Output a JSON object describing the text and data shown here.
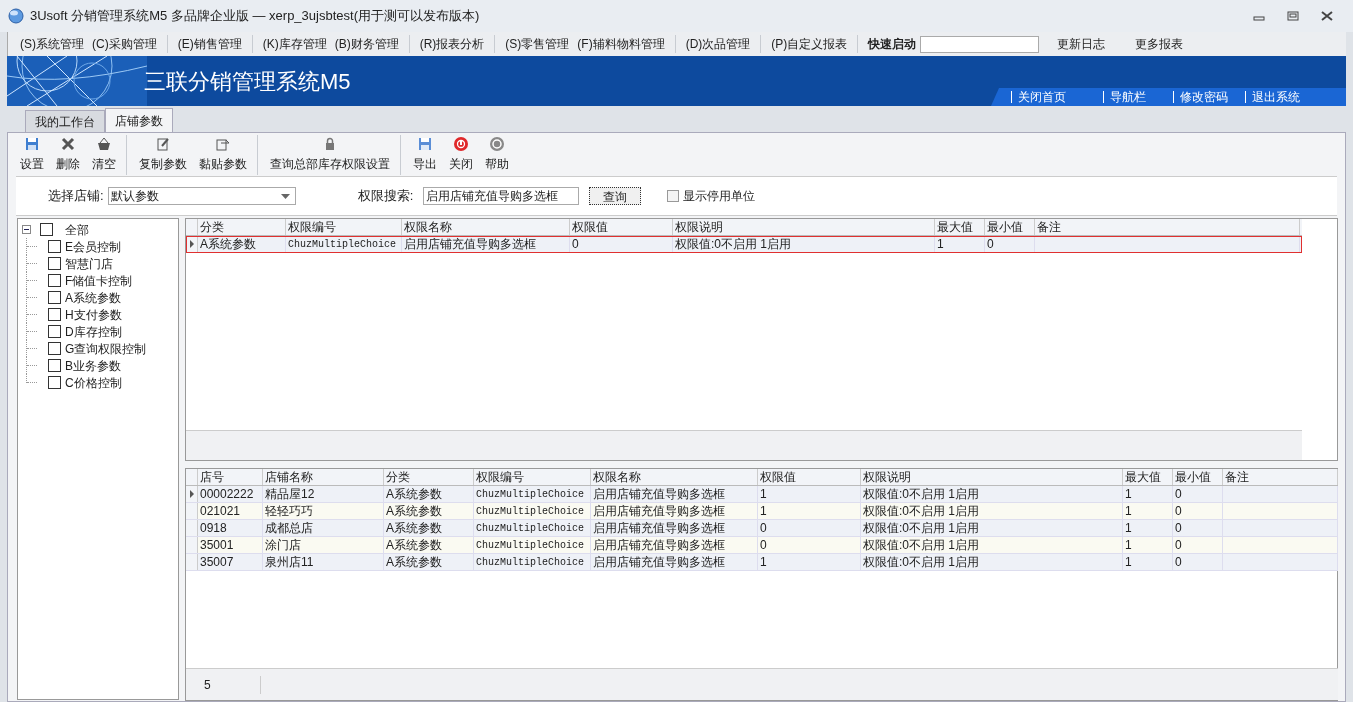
{
  "window": {
    "title": "3Usoft 分销管理系统M5 多品牌企业版 — xerp_3ujsbtest(用于测可以发布版本)"
  },
  "menu": [
    {
      "label": "(S)系统管理",
      "group_end": false
    },
    {
      "label": "(C)采购管理",
      "group_end": true
    },
    {
      "label": "(E)销售管理",
      "group_end": true
    },
    {
      "label": "(K)库存管理",
      "group_end": false
    },
    {
      "label": "(B)财务管理",
      "group_end": true
    },
    {
      "label": "(R)报表分析",
      "group_end": true
    },
    {
      "label": "(S)零售管理",
      "group_end": false
    },
    {
      "label": "(F)辅料物料管理",
      "group_end": true
    },
    {
      "label": "(D)次品管理",
      "group_end": true
    },
    {
      "label": "(P)自定义报表",
      "group_end": true
    }
  ],
  "quick_launch": {
    "label": "快速启动"
  },
  "menu_links": [
    "更新日志",
    "更多报表"
  ],
  "banner": {
    "title": "三联分销管理系统M5",
    "links": [
      "关闭首页",
      "导航栏",
      "修改密码",
      "退出系统"
    ]
  },
  "tabs": [
    {
      "label": "我的工作台",
      "selected": false
    },
    {
      "label": "店铺参数",
      "selected": true
    }
  ],
  "toolbar": [
    {
      "label": "设置",
      "group_end": false
    },
    {
      "label": "删除",
      "group_end": false
    },
    {
      "label": "清空",
      "group_end": true
    },
    {
      "label": "复制参数",
      "group_end": false
    },
    {
      "label": "黏贴参数",
      "group_end": true
    },
    {
      "label": "查询总部库存权限设置",
      "group_end": true
    },
    {
      "label": "导出",
      "group_end": false
    },
    {
      "label": "关闭",
      "group_end": false
    },
    {
      "label": "帮助",
      "group_end": false
    }
  ],
  "filter": {
    "store_label": "选择店铺:",
    "store_value": "默认参数",
    "search_label": "权限搜索:",
    "search_value": "启用店铺充值导购多选框",
    "search_button": "查询",
    "show_disabled": {
      "label": "显示停用单位",
      "checked": false
    }
  },
  "tree": {
    "label": "全部",
    "checked": false,
    "expanded": true,
    "children": [
      {
        "label": "E会员控制",
        "checked": false
      },
      {
        "label": "智慧门店",
        "checked": false
      },
      {
        "label": "F储值卡控制",
        "checked": false
      },
      {
        "label": "A系统参数",
        "checked": false
      },
      {
        "label": "H支付参数",
        "checked": false
      },
      {
        "label": "D库存控制",
        "checked": false
      },
      {
        "label": "G查询权限控制",
        "checked": false
      },
      {
        "label": "B业务参数",
        "checked": false
      },
      {
        "label": "C价格控制",
        "checked": false
      }
    ]
  },
  "upper_table": {
    "columns": [
      "分类",
      "权限编号",
      "权限名称",
      "权限值",
      "权限说明",
      "最大值",
      "最小值",
      "备注"
    ],
    "rows": [
      {
        "cells": [
          "A系统参数",
          "ChuzMultipleChoice",
          "启用店铺充值导购多选框",
          "0",
          "权限值:0不启用 1启用",
          "1",
          "0",
          ""
        ],
        "selected": true
      }
    ]
  },
  "lower_table": {
    "columns": [
      "店号",
      "店铺名称",
      "分类",
      "权限编号",
      "权限名称",
      "权限值",
      "权限说明",
      "最大值",
      "最小值",
      "备注"
    ],
    "rows": [
      {
        "cells": [
          "00002222",
          "精品屋12",
          "A系统参数",
          "ChuzMultipleChoice",
          "启用店铺充值导购多选框",
          "1",
          "权限值:0不启用 1启用",
          "1",
          "0",
          ""
        ],
        "selected": true
      },
      {
        "cells": [
          "021021",
          "轻轻巧巧",
          "A系统参数",
          "ChuzMultipleChoice",
          "启用店铺充值导购多选框",
          "1",
          "权限值:0不启用 1启用",
          "1",
          "0",
          ""
        ],
        "selected": false
      },
      {
        "cells": [
          "0918",
          "成都总店",
          "A系统参数",
          "ChuzMultipleChoice",
          "启用店铺充值导购多选框",
          "0",
          "权限值:0不启用 1启用",
          "1",
          "0",
          ""
        ],
        "selected": false
      },
      {
        "cells": [
          "35001",
          "涂门店",
          "A系统参数",
          "ChuzMultipleChoice",
          "启用店铺充值导购多选框",
          "0",
          "权限值:0不启用 1启用",
          "1",
          "0",
          ""
        ],
        "selected": false
      },
      {
        "cells": [
          "35007",
          "泉州店11",
          "A系统参数",
          "ChuzMultipleChoice",
          "启用店铺充值导购多选框",
          "1",
          "权限值:0不启用 1启用",
          "1",
          "0",
          ""
        ],
        "selected": false
      }
    ],
    "footer_count": "5"
  }
}
